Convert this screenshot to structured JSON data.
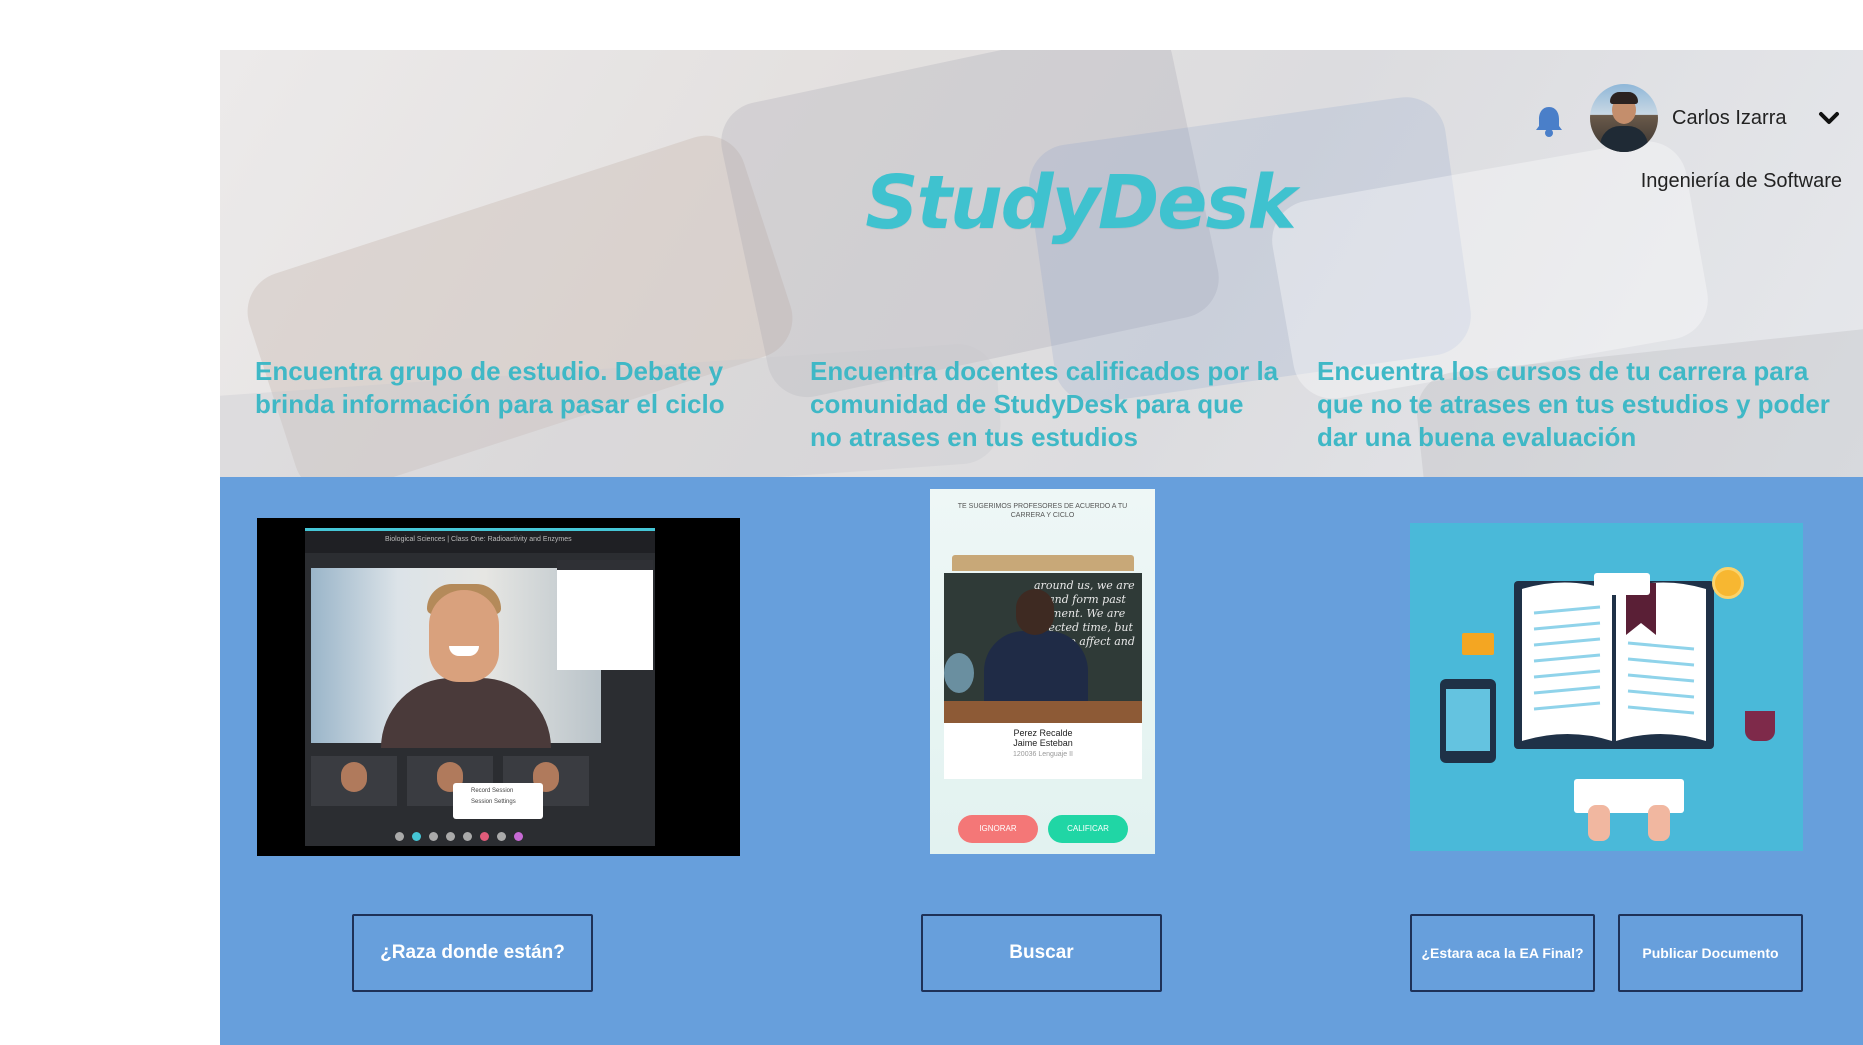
{
  "app": {
    "logo": "StudyDesk"
  },
  "user": {
    "name": "Carlos Izarra",
    "career": "Ingeniería de Software",
    "notification_icon": "bell-icon",
    "menu_icon": "chevron-down-icon"
  },
  "features": [
    {
      "text": "Encuentra grupo de estudio. Debate y brinda información para pasar el ciclo"
    },
    {
      "text": "Encuentra docentes calificados por la comunidad de StudyDesk para que no atrases en tus estudios"
    },
    {
      "text": "Encuentra los cursos de tu carrera para que no te atrases en tus estudios y poder dar una buena evaluación"
    }
  ],
  "cards": {
    "video": {
      "title_bar": "Biological Sciences | Class One: Radioactivity and Enzymes",
      "menu_items": [
        "Record Session",
        "Session Settings"
      ]
    },
    "teacher": {
      "header": "TE SUGERIMOS PROFESORES DE ACUERDO A TU CARRERA Y CICLO",
      "chalk": "around us, we are in and form past moment. We are affected time, but we also affect and change",
      "lastname": "Perez  Recalde",
      "firstname": "Jaime  Esteban",
      "course": "120036 Lenguaje II",
      "ignore_label": "IGNORAR",
      "rate_label": "CALIFICAR"
    }
  },
  "buttons": {
    "groups": "¿Raza donde están?",
    "search": "Buscar",
    "final_exam": "¿Estara aca la EA Final?",
    "publish": "Publicar Documento"
  },
  "colors": {
    "accent": "#3fc2cf",
    "content_bg": "#679fdc",
    "button_border": "#1e3158"
  }
}
